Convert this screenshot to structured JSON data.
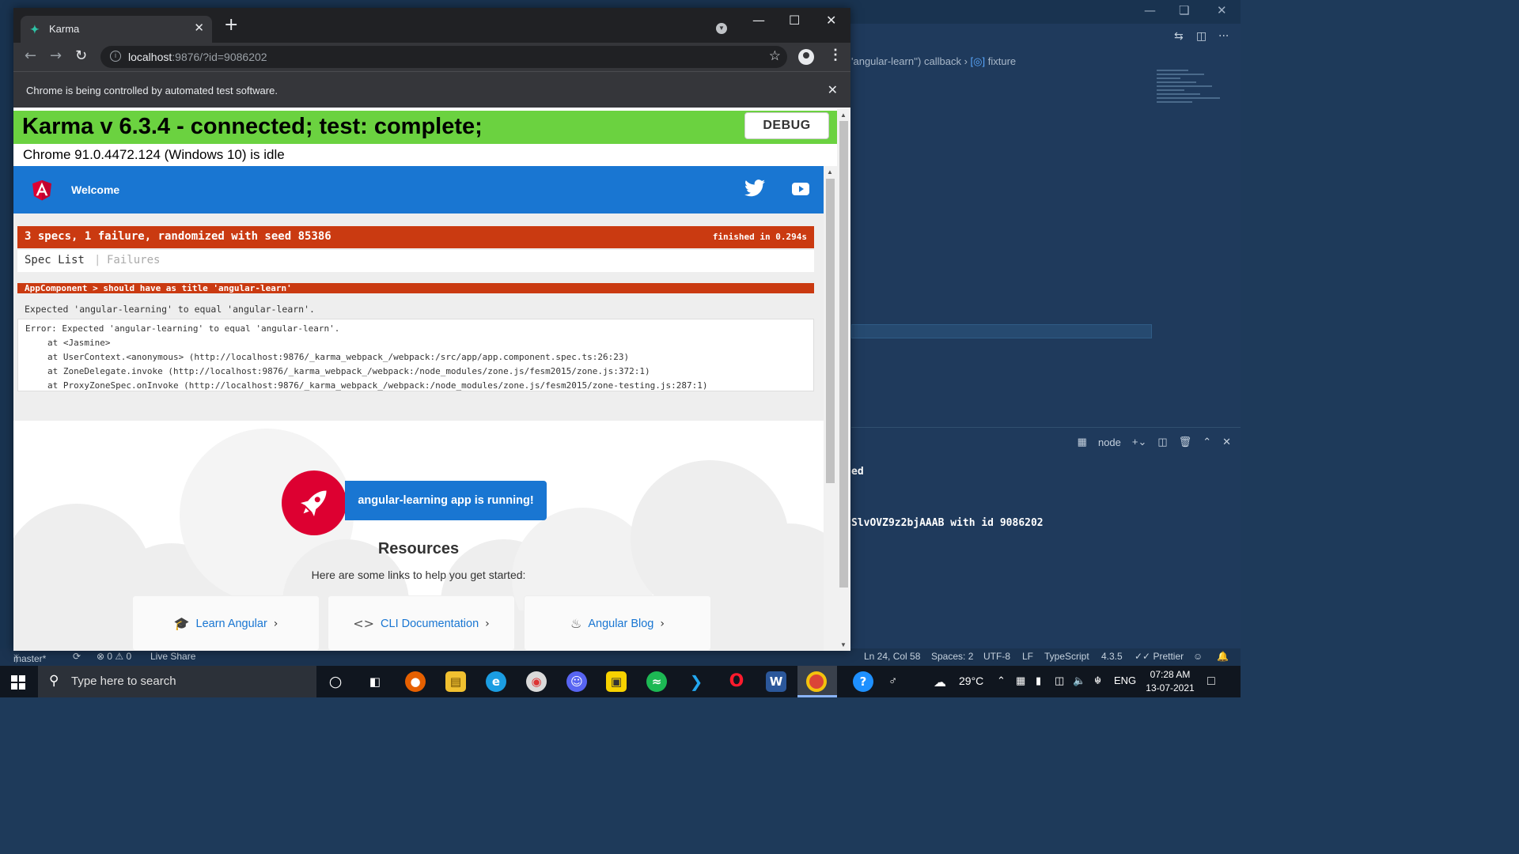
{
  "vscode": {
    "breadcrumb_text": "'angular-learn'') callback",
    "breadcrumb_symbol": "fixture",
    "terminal_label": "node",
    "terminal_lines": [
      "ed",
      "SlvOVZ9z2bjAAAB with id 9086202"
    ],
    "status": {
      "branch": "master*",
      "problems": "⊗ 0 ⚠ 0",
      "live_share": "Live Share",
      "position": "Ln 24, Col 58",
      "spaces": "Spaces: 2",
      "encoding": "UTF-8",
      "eol": "LF",
      "language": "TypeScript",
      "ts_version": "4.3.5",
      "prettier": "✓✓ Prettier"
    }
  },
  "chrome": {
    "tab_title": "Karma",
    "url_host": "localhost",
    "url_rest": ":9876/?id=9086202",
    "infobar_text": "Chrome is being controlled by automated test software."
  },
  "karma": {
    "banner": "Karma v 6.3.4 - connected; test: complete;",
    "debug_label": "DEBUG",
    "browser_status": "Chrome 91.0.4472.124 (Windows 10) is idle"
  },
  "angular": {
    "welcome": "Welcome",
    "running": "angular-learning app is running!",
    "resources_title": "Resources",
    "resources_sub": "Here are some links to help you get started:",
    "cards": [
      {
        "label": "Learn Angular",
        "icon": "mortarboard-icon"
      },
      {
        "label": "CLI Documentation",
        "icon": "code-brackets-icon"
      },
      {
        "label": "Angular Blog",
        "icon": "flame-icon"
      }
    ]
  },
  "jasmine": {
    "summary": "3 specs, 1 failure, randomized with seed 85386",
    "duration": "finished in 0.294s",
    "menu_spec_list": "Spec List",
    "menu_sep": "|",
    "menu_failures": "Failures",
    "failed_spec": "AppComponent > should have as title 'angular-learn'",
    "message": "Expected 'angular-learning' to equal 'angular-learn'.",
    "stack": [
      "Error: Expected 'angular-learning' to equal 'angular-learn'.",
      "at <Jasmine>",
      "at UserContext.<anonymous> (http://localhost:9876/_karma_webpack_/webpack:/src/app/app.component.spec.ts:26:23)",
      "at ZoneDelegate.invoke (http://localhost:9876/_karma_webpack_/webpack:/node_modules/zone.js/fesm2015/zone.js:372:1)",
      "at ProxyZoneSpec.onInvoke (http://localhost:9876/_karma_webpack_/webpack:/node_modules/zone.js/fesm2015/zone-testing.js:287:1)"
    ]
  },
  "taskbar": {
    "search_placeholder": "Type here to search",
    "weather": "29°C",
    "language": "ENG",
    "time": "07:28 AM",
    "date": "13-07-2021"
  },
  "colors": {
    "karma_green": "#6bd240",
    "jasmine_fail": "#ca3a11",
    "angular_blue": "#1976d2",
    "angular_red": "#dd0031"
  }
}
